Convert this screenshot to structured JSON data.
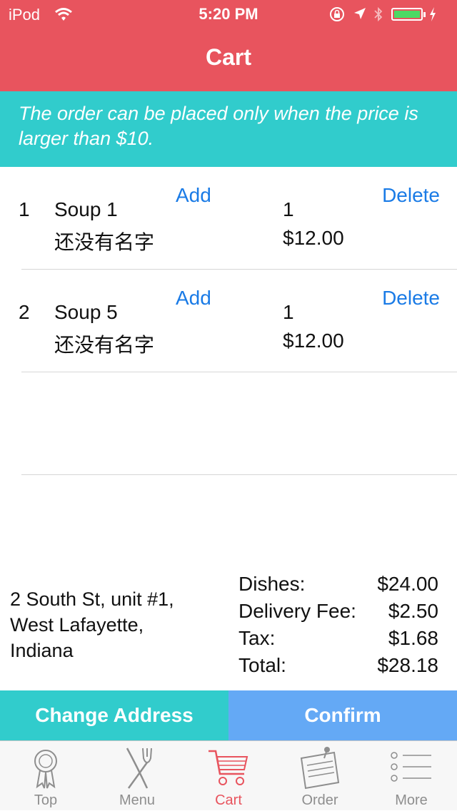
{
  "status_bar": {
    "carrier": "iPod",
    "time": "5:20 PM"
  },
  "header": {
    "title": "Cart"
  },
  "notice": {
    "text": "The order can be placed only when the price is larger than $10."
  },
  "cart": {
    "items": [
      {
        "index": "1",
        "name": "Soup 1",
        "subname": "还没有名字",
        "add_label": "Add",
        "delete_label": "Delete",
        "quantity": "1",
        "price": "$12.00"
      },
      {
        "index": "2",
        "name": "Soup 5",
        "subname": "还没有名字",
        "add_label": "Add",
        "delete_label": "Delete",
        "quantity": "1",
        "price": "$12.00"
      }
    ]
  },
  "address": {
    "line1": "2 South St, unit #1,",
    "line2": "West Lafayette,",
    "line3": "Indiana"
  },
  "totals": {
    "dishes_label": "Dishes:",
    "dishes_value": "$24.00",
    "delivery_label": "Delivery Fee:",
    "delivery_value": "$2.50",
    "tax_label": "Tax:",
    "tax_value": "$1.68",
    "total_label": "Total:",
    "total_value": "$28.18"
  },
  "actions": {
    "change_address": "Change Address",
    "confirm": "Confirm"
  },
  "tab_bar": {
    "active": "Cart",
    "tabs": [
      {
        "label": "Top",
        "icon": "ribbon-award-icon"
      },
      {
        "label": "Menu",
        "icon": "fork-knife-icon"
      },
      {
        "label": "Cart",
        "icon": "cart-icon"
      },
      {
        "label": "Order",
        "icon": "order-clipboard-icon"
      },
      {
        "label": "More",
        "icon": "list-icon"
      }
    ]
  },
  "colors": {
    "header": "#e8545e",
    "teal": "#31cccc",
    "confirm_blue": "#64a9f5",
    "link_blue": "#1a7be6",
    "tab_inactive": "#8e8e8e",
    "tab_active": "#e8545e"
  }
}
